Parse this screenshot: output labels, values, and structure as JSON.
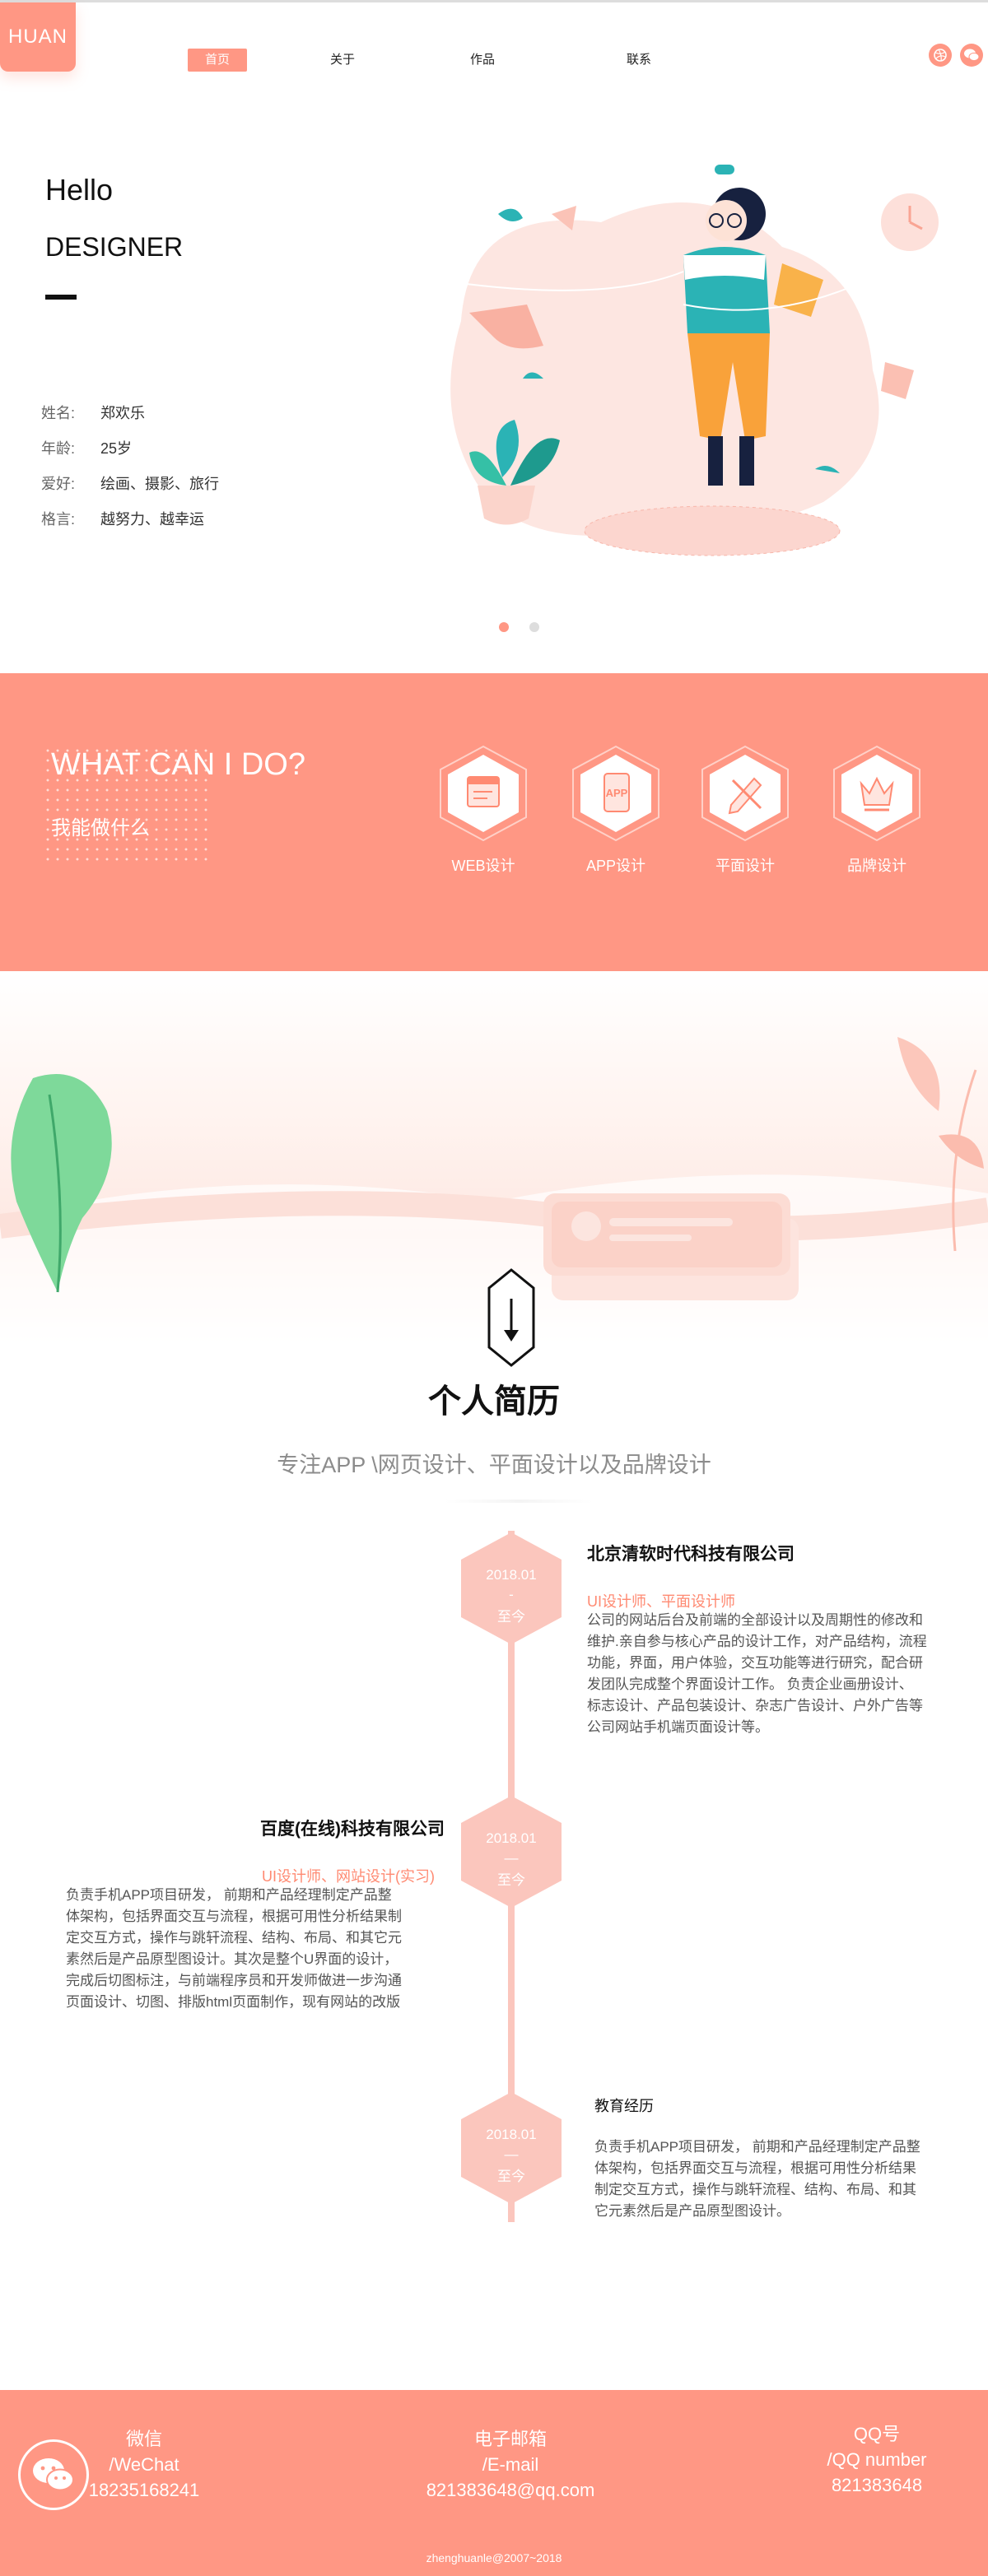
{
  "header": {
    "logo": "HUAN",
    "nav": [
      {
        "label": "首页",
        "active": true
      },
      {
        "label": "关于",
        "active": false
      },
      {
        "label": "作品",
        "active": false
      },
      {
        "label": "联系",
        "active": false
      }
    ],
    "icons": [
      "dribbble-icon",
      "wechat-icon"
    ]
  },
  "hero": {
    "hello": "Hello",
    "designer": "DESIGNER",
    "info": [
      {
        "key": "姓名:",
        "value": "郑欢乐"
      },
      {
        "key": "年龄:",
        "value": "25岁"
      },
      {
        "key": "爱好:",
        "value": "绘画、摄影、旅行"
      },
      {
        "key": "格言:",
        "value": "越努力、越幸运"
      }
    ],
    "carousel": {
      "count": 2,
      "active": 1
    }
  },
  "services": {
    "title": "WHAT CAN I DO?",
    "subtitle": "我能做什么",
    "items": [
      {
        "label": "WEB设计",
        "icon": "web-design-icon"
      },
      {
        "label": "APP设计",
        "icon": "app-design-icon"
      },
      {
        "label": "平面设计",
        "icon": "graphic-design-icon"
      },
      {
        "label": "品牌设计",
        "icon": "brand-design-icon"
      }
    ]
  },
  "resume": {
    "title": "个人简历",
    "subtitle": "专注APP \\网页设计、平面设计以及品牌设计",
    "entries": [
      {
        "date": "2018.01",
        "sep": "-",
        "until": "至今",
        "company": "北京清软时代科技有限公司",
        "role": "UI设计师、平面设计师",
        "lines": [
          "公司的网站后台及前端的全部设计以及周期性的修改和",
          "维护.亲自参与核心产品的设计工作，对产品结构，流程",
          "功能，界面，用户体验，交互功能等进行研究，配合研",
          "发团队完成整个界面设计工作。  负责企业画册设计、",
          "标志设计、产品包装设计、杂志广告设计、户外广告等",
          "公司网站手机端页面设计等。"
        ]
      },
      {
        "date": "2018.01",
        "sep": "—",
        "until": "至今",
        "company": "百度(在线)科技有限公司",
        "role": "UI设计师、网站设计(实习)",
        "lines": [
          " 负责手机APP项目研发，  前期和产品经理制定产品整",
          "体架构，包括界面交互与流程，根据可用性分析结果制",
          "定交互方式，操作与跳轩流程、结构、布局、和其它元",
          "素然后是产品原型图设计。其次是整个U界面的设计，",
          "完成后切图标注，与前端程序员和开发师做进一步沟通",
          "页面设计、切图、排版html页面制作，现有网站的改版"
        ]
      },
      {
        "date": "2018.01",
        "sep": "—",
        "until": "至今",
        "company": "教育经历",
        "role": "",
        "lines": [
          "负责手机APP项目研发，  前期和产品经理制定产品整",
          "体架构，包括界面交互与流程，根据可用性分析结果",
          "制定交互方式，操作与跳轩流程、结构、布局、和其",
          "它元素然后是产品原型图设计。"
        ]
      }
    ]
  },
  "footer": {
    "wechat": {
      "label": "微信",
      "en": "/WeChat",
      "value": "18235168241"
    },
    "email": {
      "label": "电子邮箱",
      "en": "/E-mail",
      "value": "821383648@qq.com"
    },
    "qq": {
      "label": "QQ号",
      "en": "/QQ number",
      "value": "821383648"
    },
    "copyright": "zhenghuanle@2007~2018"
  },
  "colors": {
    "accent": "#ff9784",
    "timeline": "#fbc6bd",
    "role": "#ff8a72"
  }
}
